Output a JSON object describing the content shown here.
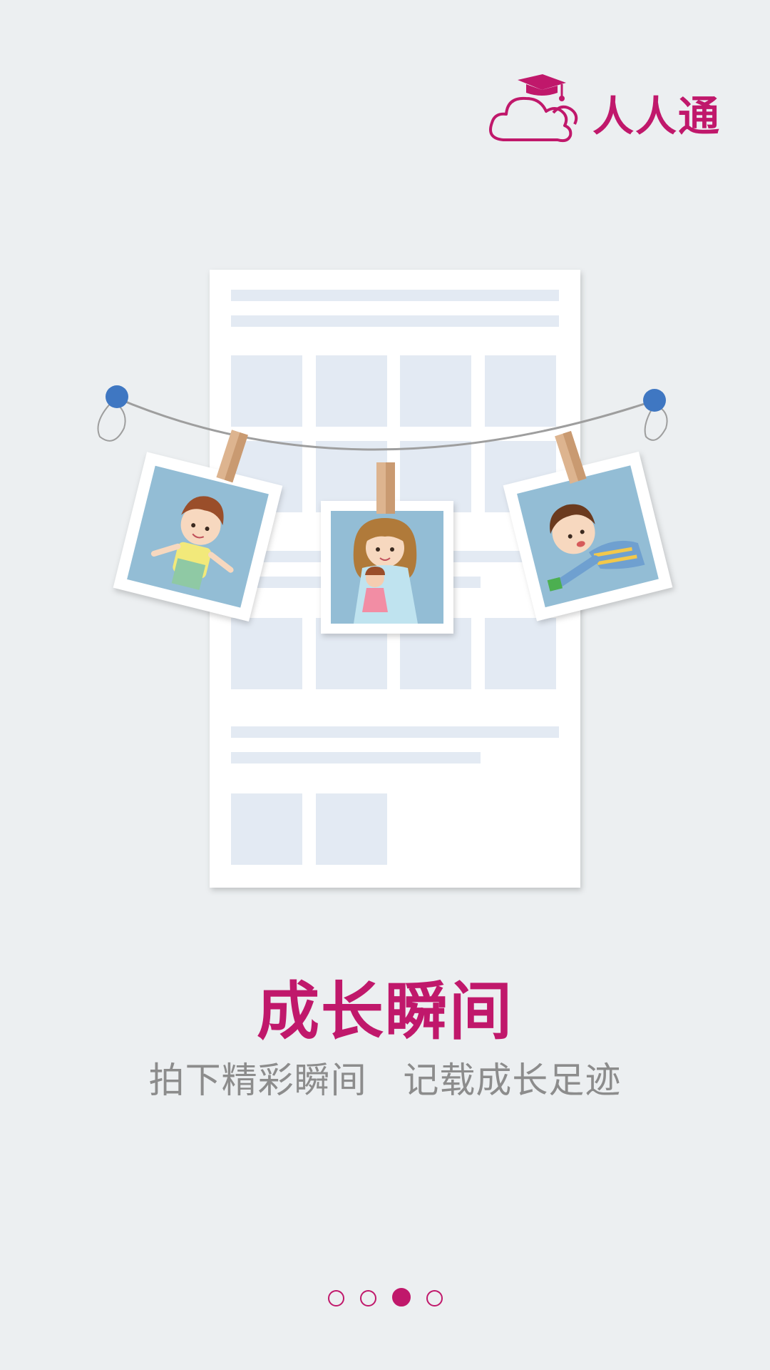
{
  "app": {
    "name": "人人通"
  },
  "intro": {
    "title": "成长瞬间",
    "subtitle": "拍下精彩瞬间   记载成长足迹"
  },
  "pager": {
    "total": 4,
    "current_index": 2
  },
  "colors": {
    "brand": "#C0186B",
    "background": "#ECEFF1",
    "subtitle_text": "#8C8C8C",
    "pin": "#3F77C2",
    "placeholder_block": "#E3EAF3",
    "photo_background": "#93BDD5",
    "clothespin": "#DDB48F"
  },
  "icons": {
    "logo": "cloud-graduation-cap-icon",
    "pins": "pushpin-icon",
    "pegs": "clothespin-icon"
  }
}
